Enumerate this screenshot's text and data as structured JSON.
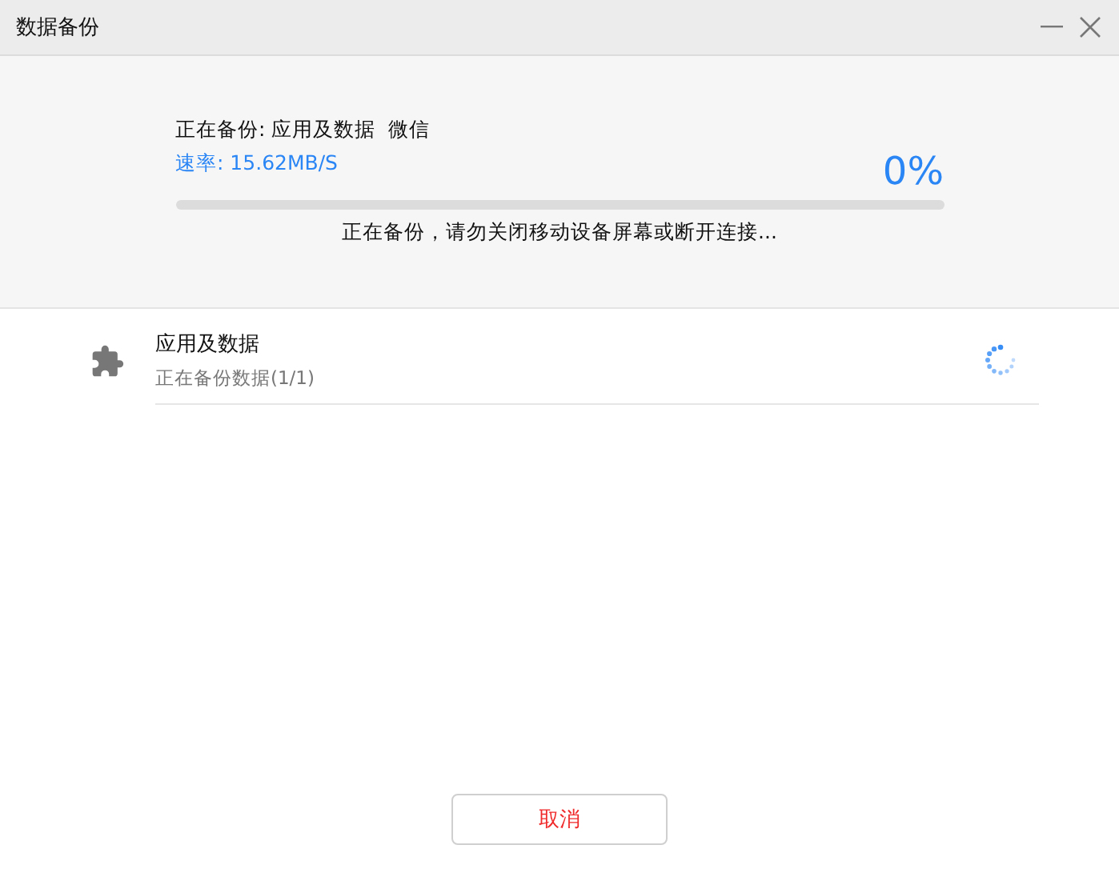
{
  "window": {
    "title": "数据备份"
  },
  "progress": {
    "current": "正在备份: 应用及数据  微信",
    "rate": "速率: 15.62MB/S",
    "percent": "0%",
    "level": 0,
    "notice": "正在备份，请勿关闭移动设备屏幕或断开连接..."
  },
  "items": [
    {
      "name": "应用及数据",
      "status": "正在备份数据(1/1)",
      "busy": true
    }
  ],
  "buttons": [
    {
      "label": "取消"
    }
  ]
}
